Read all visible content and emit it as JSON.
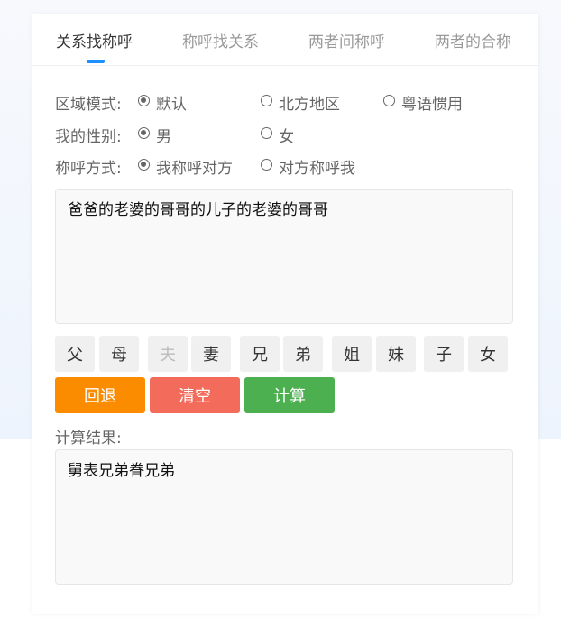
{
  "tabs": [
    {
      "label": "关系找称呼",
      "active": true
    },
    {
      "label": "称呼找关系",
      "active": false
    },
    {
      "label": "两者间称呼",
      "active": false
    },
    {
      "label": "两者的合称",
      "active": false
    }
  ],
  "options": {
    "region": {
      "label": "区域模式:",
      "choices": [
        "默认",
        "北方地区",
        "粤语惯用"
      ],
      "selected": "默认"
    },
    "gender": {
      "label": "我的性别:",
      "choices": [
        "男",
        "女"
      ],
      "selected": "男"
    },
    "mode": {
      "label": "称呼方式:",
      "choices": [
        "我称呼对方",
        "对方称呼我"
      ],
      "selected": "我称呼对方"
    }
  },
  "input": {
    "value": "爸爸的老婆的哥哥的儿子的老婆的哥哥"
  },
  "keys": [
    {
      "label": "父",
      "disabled": false
    },
    {
      "label": "母",
      "disabled": false
    },
    {
      "label": "夫",
      "disabled": true
    },
    {
      "label": "妻",
      "disabled": false
    },
    {
      "label": "兄",
      "disabled": false
    },
    {
      "label": "弟",
      "disabled": false
    },
    {
      "label": "姐",
      "disabled": false
    },
    {
      "label": "妹",
      "disabled": false
    },
    {
      "label": "子",
      "disabled": false
    },
    {
      "label": "女",
      "disabled": false
    }
  ],
  "actions": {
    "back": {
      "label": "回退",
      "color": "#fb8c00"
    },
    "clear": {
      "label": "清空",
      "color": "#f26b5b"
    },
    "calc": {
      "label": "计算",
      "color": "#4caf50"
    }
  },
  "result": {
    "label": "计算结果:",
    "value": "舅表兄弟眷兄弟"
  },
  "colors": {
    "accent": "#1e90ff"
  }
}
